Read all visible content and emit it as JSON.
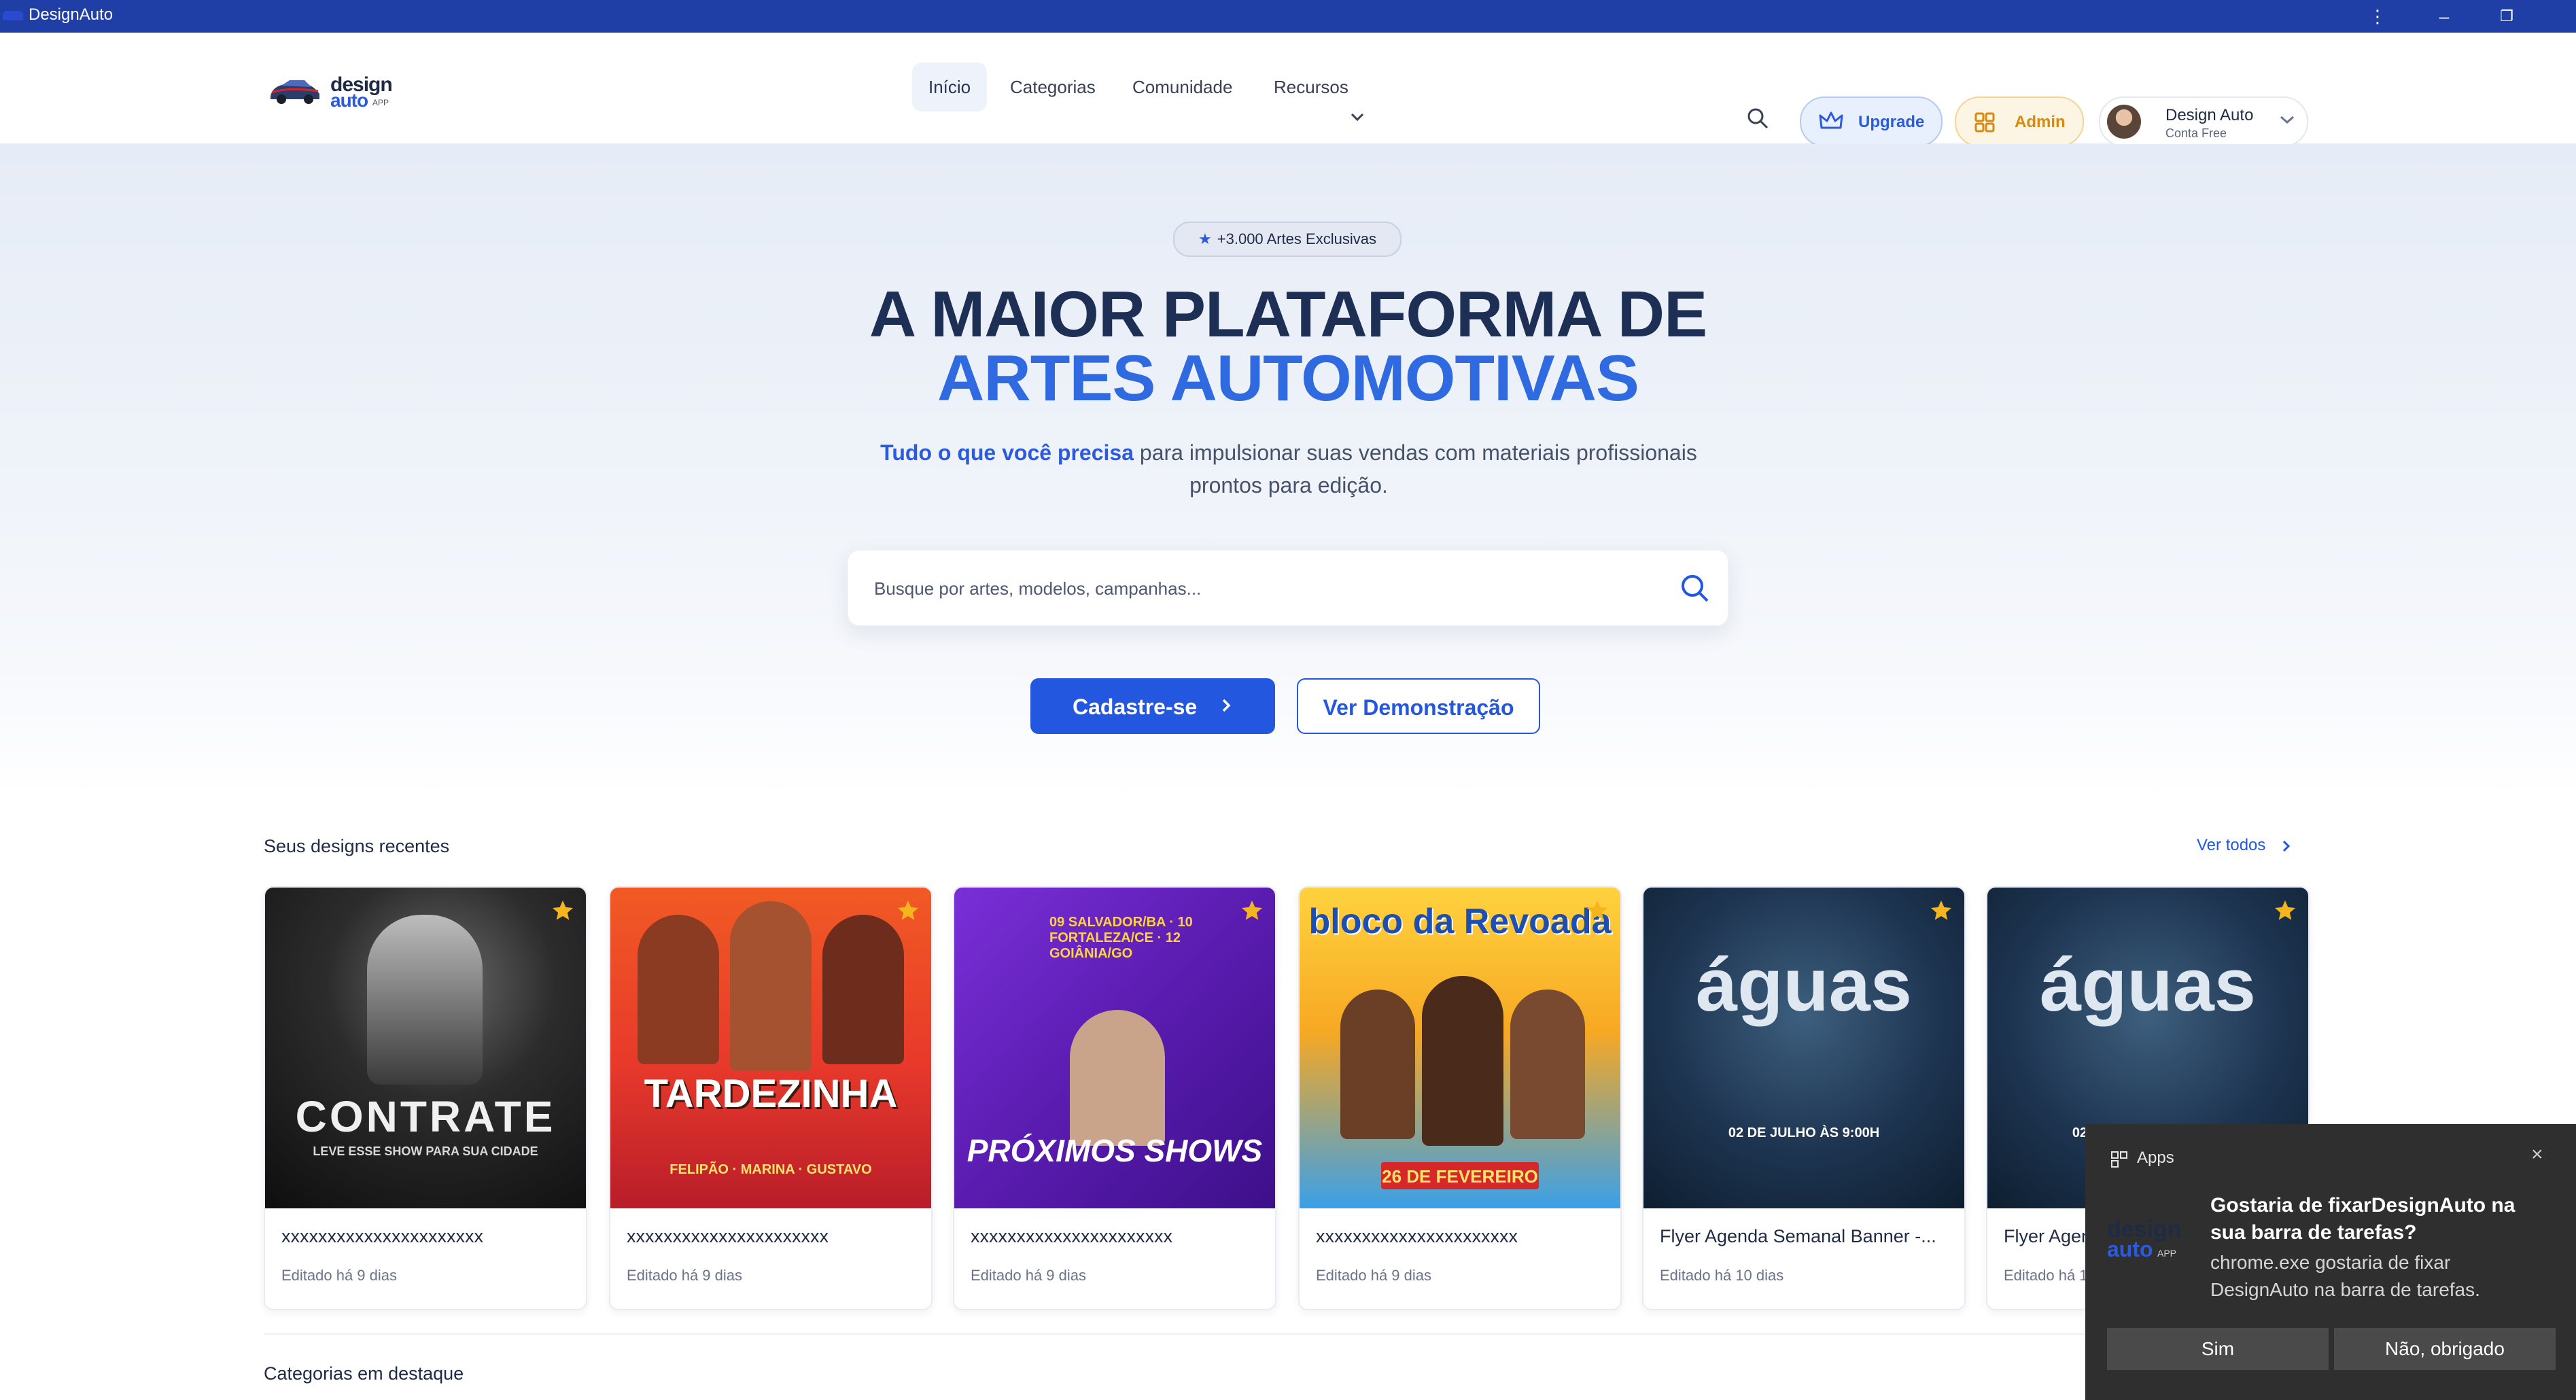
{
  "window": {
    "title": "DesignAuto"
  },
  "brand": {
    "word1": "design",
    "word2": "auto",
    "suffix": "APP"
  },
  "nav": {
    "items": [
      "Início",
      "Categorias",
      "Comunidade",
      "Recursos"
    ]
  },
  "header": {
    "upgrade_label": "Upgrade",
    "admin_label": "Admin",
    "user_name": "Design Auto",
    "user_plan": "Conta Free"
  },
  "hero": {
    "badge": "+3.000 Artes Exclusivas",
    "title_line1": "A MAIOR PLATAFORMA DE",
    "title_line2": "ARTES AUTOMOTIVAS",
    "subtitle_highlight": "Tudo o que você precisa",
    "subtitle_rest": " para impulsionar suas vendas com materiais profissionais prontos para edição.",
    "search_placeholder": "Busque por artes, modelos, campanhas...",
    "primary_button": "Cadastre-se",
    "secondary_button": "Ver Demonstração"
  },
  "recent": {
    "title": "Seus designs recentes",
    "see_all": "Ver todos",
    "cards": [
      {
        "title": "xxxxxxxxxxxxxxxxxxxxxx",
        "date": "Editado há 9 dias",
        "art_text": "CONTRATE",
        "art_sub": "LEVE ESSE SHOW PARA SUA CIDADE"
      },
      {
        "title": "xxxxxxxxxxxxxxxxxxxxxx",
        "date": "Editado há 9 dias",
        "art_text": "TARDEZINHA",
        "art_sub": "FELIPÃO · MARINA · GUSTAVO"
      },
      {
        "title": "xxxxxxxxxxxxxxxxxxxxxx",
        "date": "Editado há 9 dias",
        "art_text": "PRÓXIMOS SHOWS",
        "art_sub": "09 SALVADOR/BA · 10 FORTALEZA/CE · 12 GOIÂNIA/GO"
      },
      {
        "title": "xxxxxxxxxxxxxxxxxxxxxx",
        "date": "Editado há 9 dias",
        "art_text": "bloco da Revoada",
        "art_sub": "26 DE FEVEREIRO"
      },
      {
        "title": "Flyer Agenda Semanal Banner -...",
        "date": "Editado há 10 dias",
        "art_text": "águas",
        "art_sub": "02 DE JULHO ÀS 9:00H"
      },
      {
        "title": "Flyer Agenda Semanal Banner -...",
        "date": "Editado há 10 dias",
        "art_text": "águas",
        "art_sub": "02 DE JULHO ÀS 9:00H"
      }
    ]
  },
  "categories": {
    "title": "Categorias em destaque"
  },
  "toast": {
    "app_label": "Apps",
    "heading": "Gostaria de fixarDesignAuto na sua barra de tarefas?",
    "body": "chrome.exe gostaria de fixar DesignAuto na barra de tarefas.",
    "yes": "Sim",
    "no": "Não, obrigado",
    "close_glyph": "×"
  },
  "colors": {
    "titlebar": "#1f3fa6",
    "primary": "#2457e0",
    "title_dark": "#1d2f55",
    "title_blue": "#2f6ae0",
    "admin": "#d78a10",
    "favorite_star": "#f5b51c"
  }
}
